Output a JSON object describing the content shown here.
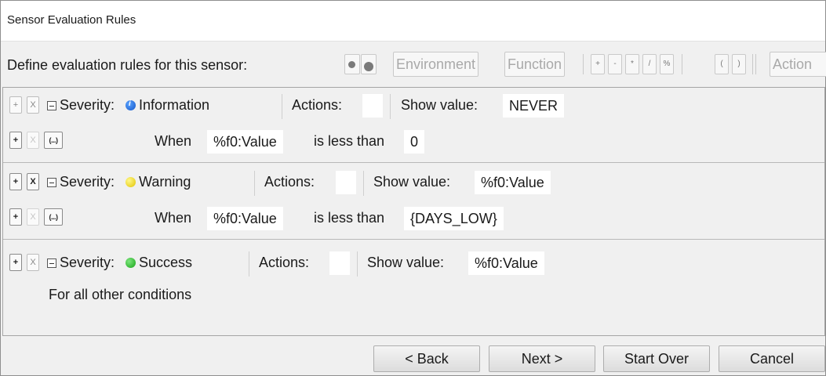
{
  "window": {
    "title": "Sensor Evaluation Rules"
  },
  "define": {
    "label": "Define evaluation rules for this sensor:",
    "toolbar": {
      "environment": "Environment",
      "function": "Function",
      "plus": "+",
      "minus": "-",
      "multiply": "*",
      "divide": "/",
      "percent": "%",
      "open_paren": "(",
      "close_paren": ")",
      "action": "Action"
    }
  },
  "rules": [
    {
      "add": "+",
      "remove": "X",
      "severity_label": "Severity:",
      "severity": "Information",
      "severity_icon": "info-icon",
      "actions_label": "Actions:",
      "actions_value": "",
      "show_label": "Show value:",
      "show_value": "NEVER",
      "cond_add": "+",
      "cond_remove": "X",
      "cond_group": "(...)",
      "when_label": "When",
      "when_value": "%f0:Value",
      "operator": "is less than",
      "operand": "0"
    },
    {
      "add": "+",
      "remove": "X",
      "severity_label": "Severity:",
      "severity": "Warning",
      "severity_icon": "warning-icon",
      "actions_label": "Actions:",
      "actions_value": "",
      "show_label": "Show value:",
      "show_value": "%f0:Value",
      "cond_add": "+",
      "cond_remove": "X",
      "cond_group": "(...)",
      "when_label": "When",
      "when_value": "%f0:Value",
      "operator": "is less than",
      "operand": "{DAYS_LOW}"
    },
    {
      "add": "+",
      "remove": "X",
      "severity_label": "Severity:",
      "severity": "Success",
      "severity_icon": "success-icon",
      "actions_label": "Actions:",
      "actions_value": "",
      "show_label": "Show value:",
      "show_value": "%f0:Value",
      "otherwise": "For all other conditions"
    }
  ],
  "buttons": {
    "back": "< Back",
    "next": "Next >",
    "start_over": "Start Over",
    "cancel": "Cancel"
  },
  "colors": {
    "info": "#1456c8",
    "warning": "#e2c400",
    "success": "#17a417"
  }
}
